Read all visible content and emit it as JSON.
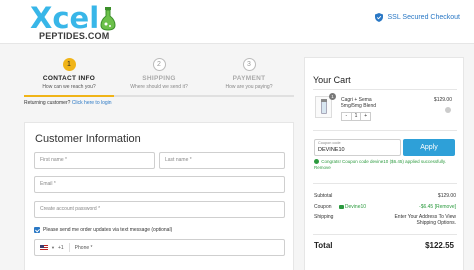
{
  "brand": {
    "logo_word": "Xcel",
    "logo_sub": "PEPTIDES.COM",
    "accent": "#38b6e8",
    "flask_color": "#6cc04a"
  },
  "header": {
    "ssl_label": "SSL Secured Checkout",
    "ssl_icon": "shield-icon"
  },
  "steps": [
    {
      "number": "1",
      "title": "CONTACT INFO",
      "subtitle": "How can we reach you?",
      "state": "active"
    },
    {
      "number": "2",
      "title": "SHIPPING",
      "subtitle": "Where should we send it?",
      "state": "inactive"
    },
    {
      "number": "3",
      "title": "PAYMENT",
      "subtitle": "How are you paying?",
      "state": "inactive"
    }
  ],
  "returning": {
    "text": "Returning customer?",
    "link": "Click here to login"
  },
  "customer_form": {
    "title": "Customer Information",
    "first_name_placeholder": "First name *",
    "last_name_placeholder": "Last name *",
    "email_placeholder": "Email *",
    "password_placeholder": "Create account password *",
    "sms_opt_in_label": "Please send me order updates via text message (optional)",
    "sms_opt_in_checked": true,
    "phone_country_code": "+1",
    "phone_placeholder": "Phone *"
  },
  "cart": {
    "title": "Your Cart",
    "items": [
      {
        "name_line1": "Cagri + Sema",
        "name_line2": "5mg/5mg Blend",
        "price": "$129.00",
        "qty": "1",
        "qty_minus": "-",
        "qty_plus": "+"
      }
    ],
    "coupon_label": "Coupon code",
    "coupon_value": "DEVINE10",
    "apply_label": "Apply",
    "coupon_message": "Congrats! Coupon code devine10 ($6.45) applied successfully.",
    "coupon_remove": "Remove",
    "subtotal_label": "Subtotal",
    "subtotal_value": "$129.00",
    "coupon_row_label": "Coupon",
    "coupon_row_code": "Devine10",
    "coupon_row_value": "-$6.45 [Remove]",
    "shipping_label": "Shipping",
    "shipping_value_line1": "Enter Your Address To View",
    "shipping_value_line2": "Shipping Options.",
    "total_label": "Total",
    "total_value": "$122.55",
    "apply_color": "#2ea0d8",
    "success_color": "#2b9a3e"
  },
  "colors": {
    "step_active": "#f0b418",
    "link": "#2a78c5"
  }
}
